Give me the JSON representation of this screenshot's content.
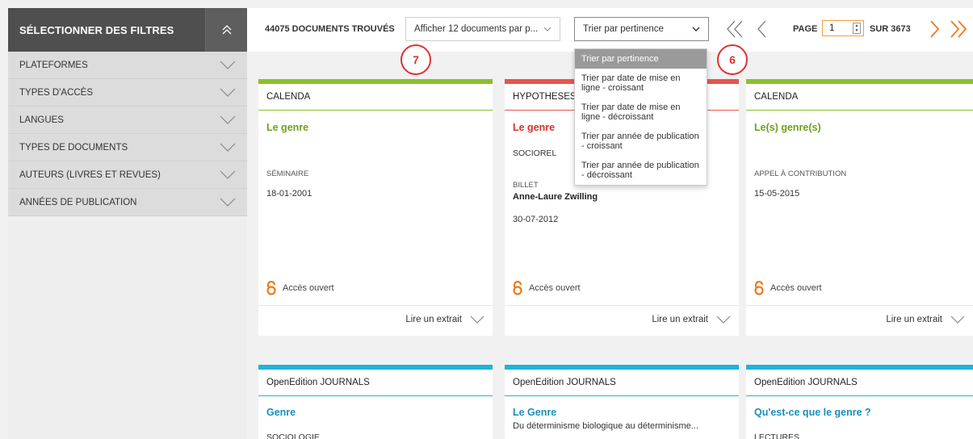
{
  "sidebar": {
    "title": "SÉLECTIONNER DES FILTRES",
    "items": [
      {
        "label": "PLATEFORMES"
      },
      {
        "label": "TYPES D'ACCÈS"
      },
      {
        "label": "LANGUES"
      },
      {
        "label": "TYPES DE DOCUMENTS"
      },
      {
        "label": "AUTEURS (LIVRES ET REVUES)"
      },
      {
        "label": "ANNÉES DE PUBLICATION"
      }
    ]
  },
  "toolbar": {
    "count": "44075 DOCUMENTS TROUVÉS",
    "perpage": "Afficher 12 documents par p...",
    "sort": "Trier par pertinence",
    "page_label": "PAGE",
    "page_value": "1",
    "total": "SUR 3673"
  },
  "markers": {
    "m7": "7",
    "m6": "6"
  },
  "dropdown": {
    "items": [
      "Trier par pertinence",
      "Trier par date de mise en ligne - croissant",
      "Trier par date de mise en ligne - décroissant",
      "Trier par année de publication - croissant",
      "Trier par année de publication - décroissant"
    ]
  },
  "cards": [
    {
      "platform": "CALENDA",
      "title": "Le genre",
      "type": "SÉMINAIRE",
      "date": "18-01-2001",
      "oa": "Accès ouvert",
      "foot": "Lire un extrait"
    },
    {
      "platform": "HYPOTHESES",
      "title": "Le genre",
      "sub": "SOCIOREL",
      "type": "BILLET",
      "author": "Anne-Laure Zwilling",
      "date": "30-07-2012",
      "oa": "Accès ouvert",
      "foot": "Lire un extrait"
    },
    {
      "platform": "CALENDA",
      "title": "Le(s) genre(s)",
      "type": "APPEL À CONTRIBUTION",
      "date": "15-05-2015",
      "oa": "Accès ouvert",
      "foot": "Lire un extrait"
    },
    {
      "platform": "OpenEdition JOURNALS",
      "title": "Genre",
      "sub": "SOCIOLOGIE"
    },
    {
      "platform": "OpenEdition JOURNALS",
      "title": "Le Genre",
      "sub": "Du déterminisme biologique au déterminisme..."
    },
    {
      "platform": "OpenEdition JOURNALS",
      "title": "Qu'est-ce que le genre ?",
      "sub": "LECTURES"
    }
  ],
  "colors": {
    "calenda": "#8dbf2e",
    "hypotheses": "#e8554e",
    "journals": "#1eb4d8",
    "orange": "#f07a1a"
  }
}
